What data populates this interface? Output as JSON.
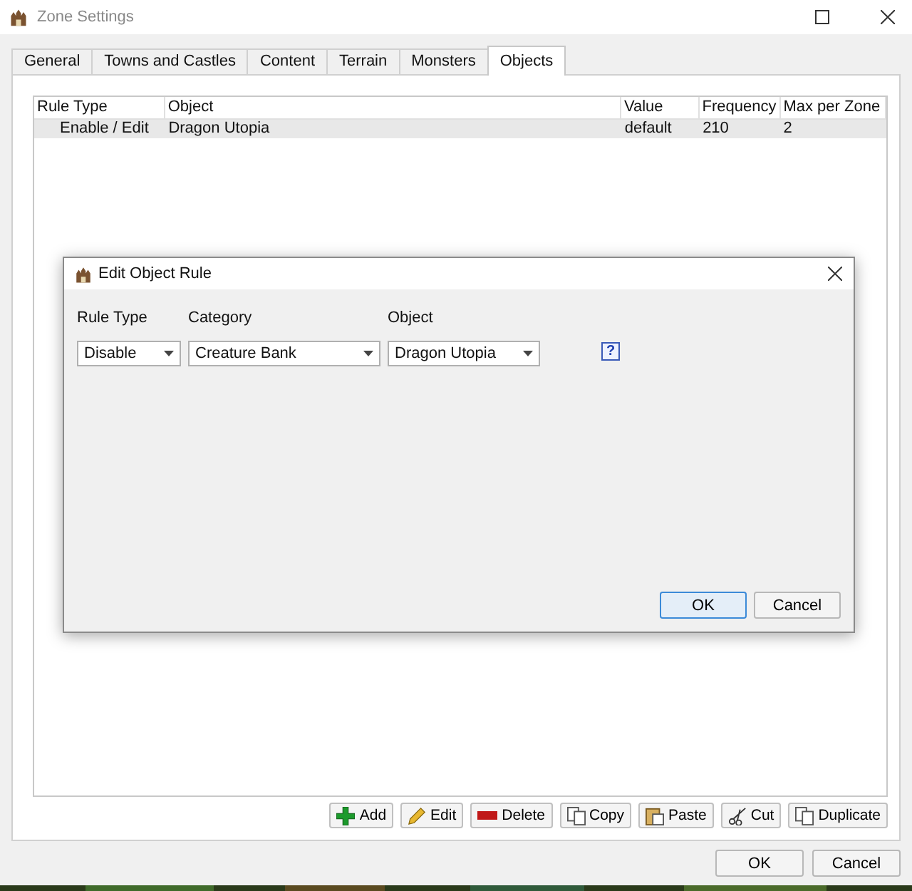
{
  "window": {
    "title": "Zone Settings"
  },
  "tabs": [
    {
      "label": "General",
      "selected": false
    },
    {
      "label": "Towns and Castles",
      "selected": false
    },
    {
      "label": "Content",
      "selected": false
    },
    {
      "label": "Terrain",
      "selected": false
    },
    {
      "label": "Monsters",
      "selected": false
    },
    {
      "label": "Objects",
      "selected": true
    }
  ],
  "table": {
    "columns": [
      "Rule Type",
      "Object",
      "Value",
      "Frequency",
      "Max per Zone"
    ],
    "rows": [
      {
        "cells": [
          "Enable / Edit",
          "Dragon Utopia",
          "default",
          "210",
          "2"
        ],
        "selected": true
      }
    ]
  },
  "toolbar": [
    {
      "label": "Add",
      "kind": "add"
    },
    {
      "label": "Edit",
      "kind": "edit"
    },
    {
      "label": "Delete",
      "kind": "delete"
    },
    {
      "label": "Copy",
      "kind": "copy"
    },
    {
      "label": "Paste",
      "kind": "paste"
    },
    {
      "label": "Cut",
      "kind": "cut"
    },
    {
      "label": "Duplicate",
      "kind": "copy"
    }
  ],
  "buttons": [
    {
      "label": "OK",
      "default": false
    },
    {
      "label": "Cancel",
      "default": false
    }
  ],
  "dialog": {
    "title": "Edit Object Rule",
    "fields": [
      {
        "label": "Rule Type",
        "value": "Disable"
      },
      {
        "label": "Category",
        "value": "Creature Bank"
      },
      {
        "label": "Object",
        "value": "Dragon Utopia"
      }
    ],
    "help": "?",
    "buttons": [
      {
        "label": "OK",
        "default": true
      },
      {
        "label": "Cancel",
        "default": false
      }
    ]
  }
}
